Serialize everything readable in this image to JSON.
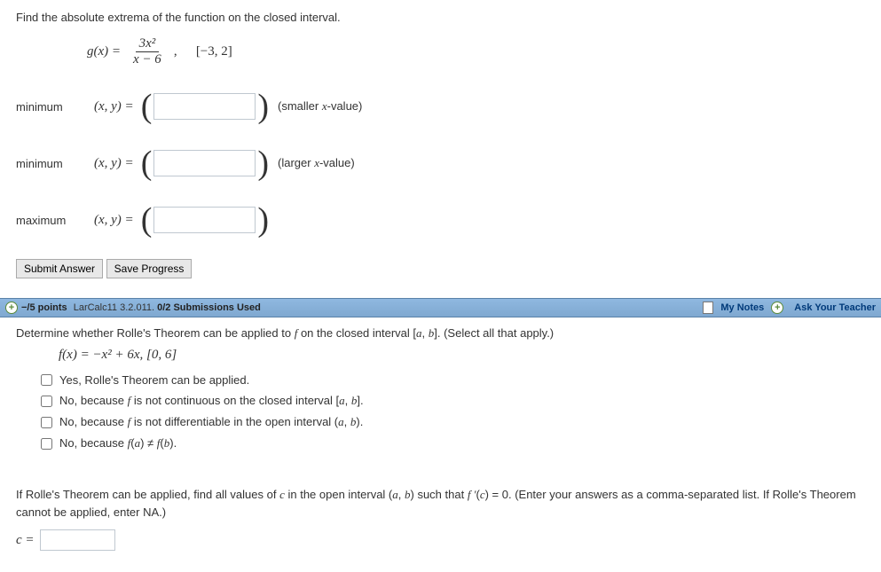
{
  "q1": {
    "instruction": "Find the absolute extrema of the function on the closed interval.",
    "func_lhs": "g(x) = ",
    "frac_num": "3x²",
    "frac_den": "x − 6",
    "interval": "[−3, 2]",
    "rows": [
      {
        "label": "minimum",
        "note": "(smaller x-value)"
      },
      {
        "label": "minimum",
        "note": "(larger x-value)"
      },
      {
        "label": "maximum",
        "note": ""
      }
    ],
    "eq_prefix": "(x, y)  =",
    "buttons": {
      "submit": "Submit Answer",
      "save": "Save Progress"
    }
  },
  "header": {
    "points": "−/5 points",
    "source": "LarCalc11 3.2.011.",
    "subs": "0/2 Submissions Used",
    "mynotes": "My Notes",
    "ask": "Ask Your Teacher"
  },
  "q2": {
    "instruction_a": "Determine whether Rolle's Theorem can be applied to ",
    "instruction_b": " on the closed interval [",
    "instruction_c": "]. (Select all that apply.)",
    "formula": "f(x) = −x² + 6x,    [0, 6]",
    "options": [
      "Yes, Rolle's Theorem can be applied.",
      "No, because f is not continuous on the closed interval [a, b].",
      "No, because f is not differentiable in the open interval (a, b).",
      "No, because f(a) ≠ f(b)."
    ],
    "followup_a": "If Rolle's Theorem can be applied, find all values of ",
    "followup_b": " in the open interval (",
    "followup_c": ") such that ",
    "followup_d": " = 0. (Enter your answers as a comma-separated list. If Rolle's Theorem cannot be applied, enter NA.)",
    "c_label": "c ="
  }
}
